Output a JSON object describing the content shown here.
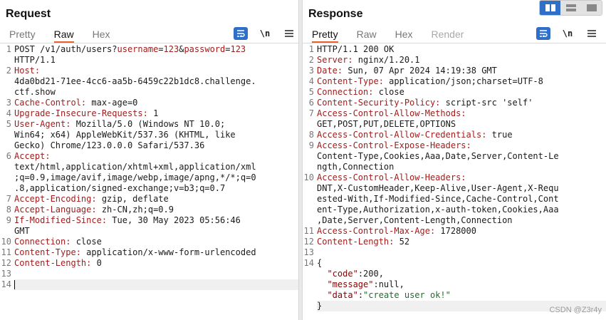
{
  "request": {
    "title": "Request",
    "tabs": [
      "Pretty",
      "Raw",
      "Hex"
    ],
    "active_tab": "Raw",
    "tools": {
      "wrap_icon": "wrap-lines-icon",
      "newline_label": "\\n",
      "menu_icon": "hamburger-menu-icon"
    },
    "lines": [
      {
        "n": "1",
        "parts": [
          [
            "t",
            "POST /v1/auth/users?"
          ],
          [
            "p",
            "username"
          ],
          [
            "t",
            "="
          ],
          [
            "v",
            "123"
          ],
          [
            "t",
            "&"
          ],
          [
            "p",
            "password"
          ],
          [
            "t",
            "="
          ],
          [
            "v",
            "123"
          ]
        ]
      },
      {
        "n": "",
        "parts": [
          [
            "t",
            "HTTP/1.1"
          ]
        ]
      },
      {
        "n": "2",
        "parts": [
          [
            "h",
            "Host:"
          ]
        ]
      },
      {
        "n": "",
        "parts": [
          [
            "t",
            "4da0bd21-71ee-4cc6-aa5b-6459c22b1dc8.challenge."
          ]
        ]
      },
      {
        "n": "",
        "parts": [
          [
            "t",
            "ctf.show"
          ]
        ]
      },
      {
        "n": "3",
        "parts": [
          [
            "h",
            "Cache-Control:"
          ],
          [
            "t",
            " max-age=0"
          ]
        ]
      },
      {
        "n": "4",
        "parts": [
          [
            "h",
            "Upgrade-Insecure-Requests:"
          ],
          [
            "t",
            " 1"
          ]
        ]
      },
      {
        "n": "5",
        "parts": [
          [
            "h",
            "User-Agent:"
          ],
          [
            "t",
            " Mozilla/5.0 (Windows NT 10.0;"
          ]
        ]
      },
      {
        "n": "",
        "parts": [
          [
            "t",
            "Win64; x64) AppleWebKit/537.36 (KHTML, like"
          ]
        ]
      },
      {
        "n": "",
        "parts": [
          [
            "t",
            "Gecko) Chrome/123.0.0.0 Safari/537.36"
          ]
        ]
      },
      {
        "n": "6",
        "parts": [
          [
            "h",
            "Accept:"
          ]
        ]
      },
      {
        "n": "",
        "parts": [
          [
            "t",
            "text/html,application/xhtml+xml,application/xml"
          ]
        ]
      },
      {
        "n": "",
        "parts": [
          [
            "t",
            ";q=0.9,image/avif,image/webp,image/apng,*/*;q=0"
          ]
        ]
      },
      {
        "n": "",
        "parts": [
          [
            "t",
            ".8,application/signed-exchange;v=b3;q=0.7"
          ]
        ]
      },
      {
        "n": "7",
        "parts": [
          [
            "h",
            "Accept-Encoding:"
          ],
          [
            "t",
            " gzip, deflate"
          ]
        ]
      },
      {
        "n": "8",
        "parts": [
          [
            "h",
            "Accept-Language:"
          ],
          [
            "t",
            " zh-CN,zh;q=0.9"
          ]
        ]
      },
      {
        "n": "9",
        "parts": [
          [
            "h",
            "If-Modified-Since:"
          ],
          [
            "t",
            " Tue, 30 May 2023 05:56:46"
          ]
        ]
      },
      {
        "n": "",
        "parts": [
          [
            "t",
            "GMT"
          ]
        ]
      },
      {
        "n": "10",
        "parts": [
          [
            "h",
            "Connection:"
          ],
          [
            "t",
            " close"
          ]
        ]
      },
      {
        "n": "11",
        "parts": [
          [
            "h",
            "Content-Type:"
          ],
          [
            "t",
            " application/x-www-form-urlencoded"
          ]
        ]
      },
      {
        "n": "12",
        "parts": [
          [
            "h",
            "Content-Length:"
          ],
          [
            "t",
            " 0"
          ]
        ]
      },
      {
        "n": "13",
        "parts": []
      },
      {
        "n": "14",
        "parts": [],
        "cursor": true
      }
    ]
  },
  "response": {
    "title": "Response",
    "tabs": [
      "Pretty",
      "Raw",
      "Hex",
      "Render"
    ],
    "active_tab": "Pretty",
    "disabled_tab": "Render",
    "tools": {
      "wrap_icon": "wrap-lines-icon",
      "newline_label": "\\n",
      "menu_icon": "hamburger-menu-icon"
    },
    "lines": [
      {
        "n": "1",
        "parts": [
          [
            "t",
            "HTTP/1.1 200 OK"
          ]
        ]
      },
      {
        "n": "2",
        "parts": [
          [
            "h",
            "Server:"
          ],
          [
            "t",
            " nginx/1.20.1"
          ]
        ]
      },
      {
        "n": "3",
        "parts": [
          [
            "h",
            "Date:"
          ],
          [
            "t",
            " Sun, 07 Apr 2024 14:19:38 GMT"
          ]
        ]
      },
      {
        "n": "4",
        "parts": [
          [
            "h",
            "Content-Type:"
          ],
          [
            "t",
            " application/json;charset=UTF-8"
          ]
        ]
      },
      {
        "n": "5",
        "parts": [
          [
            "h",
            "Connection:"
          ],
          [
            "t",
            " close"
          ]
        ]
      },
      {
        "n": "6",
        "parts": [
          [
            "h",
            "Content-Security-Policy:"
          ],
          [
            "t",
            " script-src 'self'"
          ]
        ]
      },
      {
        "n": "7",
        "parts": [
          [
            "h",
            "Access-Control-Allow-Methods:"
          ]
        ]
      },
      {
        "n": "",
        "parts": [
          [
            "t",
            "GET,POST,PUT,DELETE,OPTIONS"
          ]
        ]
      },
      {
        "n": "8",
        "parts": [
          [
            "h",
            "Access-Control-Allow-Credentials:"
          ],
          [
            "t",
            " true"
          ]
        ]
      },
      {
        "n": "9",
        "parts": [
          [
            "h",
            "Access-Control-Expose-Headers:"
          ]
        ]
      },
      {
        "n": "",
        "parts": [
          [
            "t",
            "Content-Type,Cookies,Aaa,Date,Server,Content-Le"
          ]
        ]
      },
      {
        "n": "",
        "parts": [
          [
            "t",
            "ngth,Connection"
          ]
        ]
      },
      {
        "n": "10",
        "parts": [
          [
            "h",
            "Access-Control-Allow-Headers:"
          ]
        ]
      },
      {
        "n": "",
        "parts": [
          [
            "t",
            "DNT,X-CustomHeader,Keep-Alive,User-Agent,X-Requ"
          ]
        ]
      },
      {
        "n": "",
        "parts": [
          [
            "t",
            "ested-With,If-Modified-Since,Cache-Control,Cont"
          ]
        ]
      },
      {
        "n": "",
        "parts": [
          [
            "t",
            "ent-Type,Authorization,x-auth-token,Cookies,Aaa"
          ]
        ]
      },
      {
        "n": "",
        "parts": [
          [
            "t",
            ",Date,Server,Content-Length,Connection"
          ]
        ]
      },
      {
        "n": "11",
        "parts": [
          [
            "h",
            "Access-Control-Max-Age:"
          ],
          [
            "t",
            " 1728000"
          ]
        ]
      },
      {
        "n": "12",
        "parts": [
          [
            "h",
            "Content-Length:"
          ],
          [
            "t",
            " 52"
          ]
        ]
      },
      {
        "n": "13",
        "parts": []
      },
      {
        "n": "14",
        "parts": [
          [
            "t",
            "{"
          ]
        ]
      },
      {
        "n": "",
        "parts": [
          [
            "t",
            "  "
          ],
          [
            "k",
            "\"code\""
          ],
          [
            "t",
            ":200,"
          ]
        ]
      },
      {
        "n": "",
        "parts": [
          [
            "t",
            "  "
          ],
          [
            "k",
            "\"message\""
          ],
          [
            "t",
            ":null,"
          ]
        ]
      },
      {
        "n": "",
        "parts": [
          [
            "t",
            "  "
          ],
          [
            "k",
            "\"data\""
          ],
          [
            "t",
            ":"
          ],
          [
            "s",
            "\"create user ok!\""
          ]
        ]
      },
      {
        "n": "",
        "parts": [
          [
            "t",
            "}"
          ]
        ],
        "highlight": true
      }
    ]
  },
  "view_switch": [
    "split-horizontal-icon",
    "split-vertical-icon",
    "single-pane-icon"
  ],
  "watermark": "CSDN @Z3r4y",
  "colors": {
    "accent": "#2f6fc7",
    "tab_underline": "#e8632b",
    "header_name": "#a01d1d",
    "json_string": "#1f6f2a"
  }
}
